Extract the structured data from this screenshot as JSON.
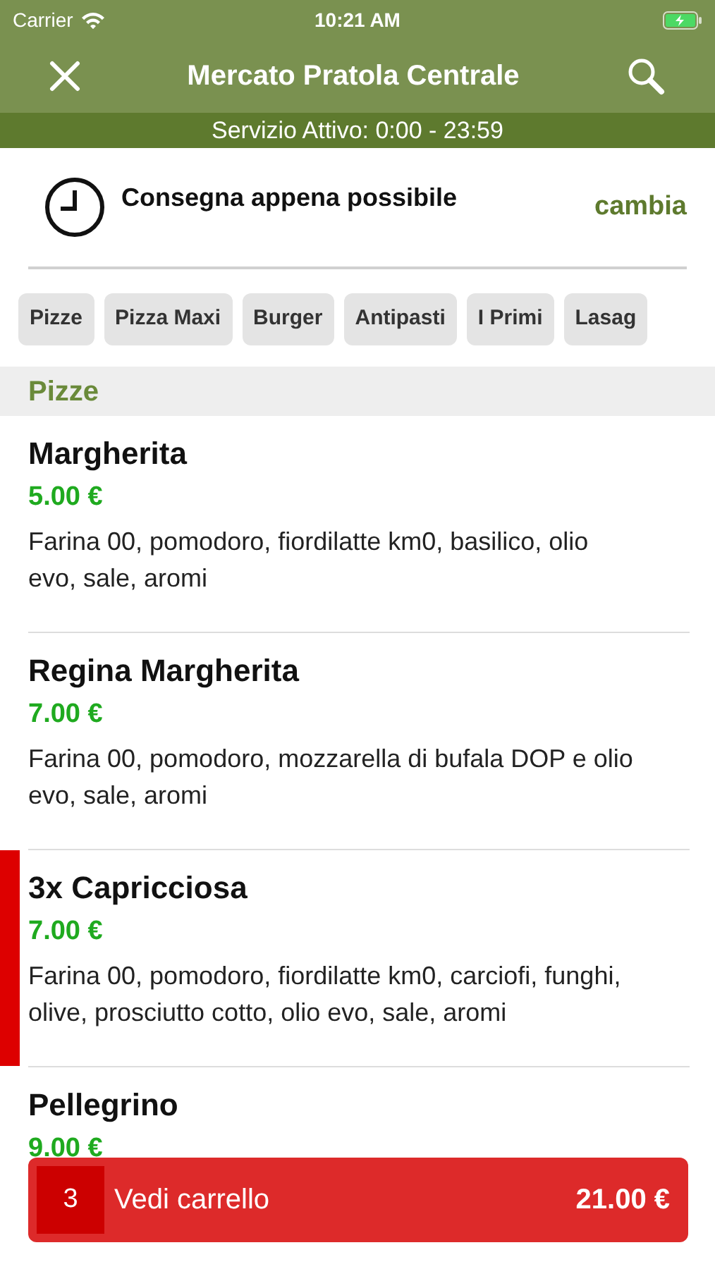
{
  "status_bar": {
    "carrier": "Carrier",
    "time": "10:21 AM"
  },
  "nav": {
    "title": "Mercato Pratola Centrale"
  },
  "service_banner": "Servizio Attivo: 0:00 - 23:59",
  "delivery": {
    "label": "Consegna appena possibile",
    "action": "cambia"
  },
  "categories": [
    {
      "label": "Pizze"
    },
    {
      "label": "Pizza Maxi"
    },
    {
      "label": "Burger"
    },
    {
      "label": "Antipasti"
    },
    {
      "label": "I Primi"
    },
    {
      "label": "Lasag"
    }
  ],
  "section": "Pizze",
  "items": [
    {
      "name": "Margherita",
      "price": "5.00 €",
      "description": "Farina 00, pomodoro, fiordilatte km0, basilico, olio evo, sale, aromi",
      "in_cart": false
    },
    {
      "name": "Regina Margherita",
      "price": "7.00 €",
      "description": "Farina 00, pomodoro, mozzarella di bufala DOP e olio evo, sale, aromi",
      "in_cart": false
    },
    {
      "name": "3x Capricciosa",
      "price": "7.00 €",
      "description": "Farina 00, pomodoro, fiordilatte km0, carciofi, funghi, olive, prosciutto cotto, olio evo, sale, aromi",
      "in_cart": true
    },
    {
      "name": "Pellegrino",
      "price": "9.00 €",
      "in_cart": false
    }
  ],
  "cart": {
    "count": "3",
    "label": "Vedi carrello",
    "total": "21.00 €"
  }
}
